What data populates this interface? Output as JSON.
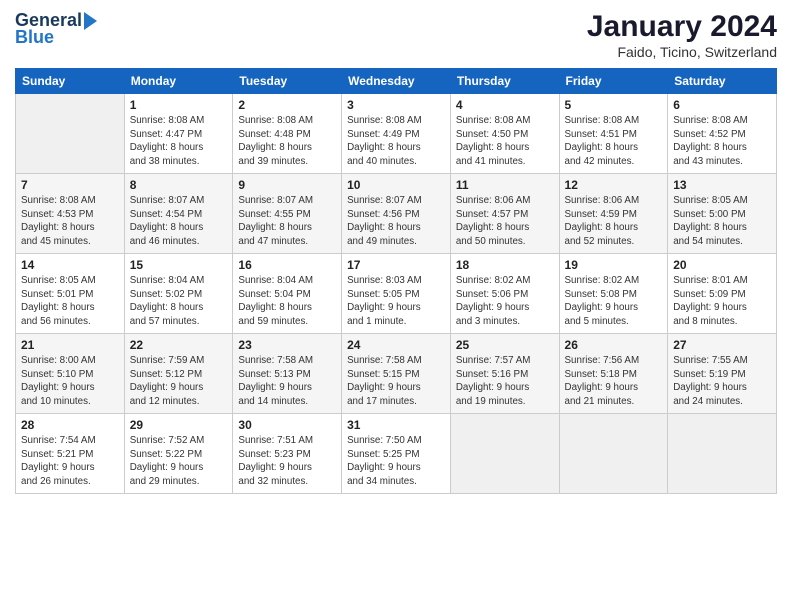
{
  "header": {
    "logo_general": "General",
    "logo_blue": "Blue",
    "month_title": "January 2024",
    "location": "Faido, Ticino, Switzerland"
  },
  "days_of_week": [
    "Sunday",
    "Monday",
    "Tuesday",
    "Wednesday",
    "Thursday",
    "Friday",
    "Saturday"
  ],
  "weeks": [
    [
      {
        "day": "",
        "sunrise": "",
        "sunset": "",
        "daylight": ""
      },
      {
        "day": "1",
        "sunrise": "Sunrise: 8:08 AM",
        "sunset": "Sunset: 4:47 PM",
        "daylight": "Daylight: 8 hours and 38 minutes."
      },
      {
        "day": "2",
        "sunrise": "Sunrise: 8:08 AM",
        "sunset": "Sunset: 4:48 PM",
        "daylight": "Daylight: 8 hours and 39 minutes."
      },
      {
        "day": "3",
        "sunrise": "Sunrise: 8:08 AM",
        "sunset": "Sunset: 4:49 PM",
        "daylight": "Daylight: 8 hours and 40 minutes."
      },
      {
        "day": "4",
        "sunrise": "Sunrise: 8:08 AM",
        "sunset": "Sunset: 4:50 PM",
        "daylight": "Daylight: 8 hours and 41 minutes."
      },
      {
        "day": "5",
        "sunrise": "Sunrise: 8:08 AM",
        "sunset": "Sunset: 4:51 PM",
        "daylight": "Daylight: 8 hours and 42 minutes."
      },
      {
        "day": "6",
        "sunrise": "Sunrise: 8:08 AM",
        "sunset": "Sunset: 4:52 PM",
        "daylight": "Daylight: 8 hours and 43 minutes."
      }
    ],
    [
      {
        "day": "7",
        "sunrise": "Sunrise: 8:08 AM",
        "sunset": "Sunset: 4:53 PM",
        "daylight": "Daylight: 8 hours and 45 minutes."
      },
      {
        "day": "8",
        "sunrise": "Sunrise: 8:07 AM",
        "sunset": "Sunset: 4:54 PM",
        "daylight": "Daylight: 8 hours and 46 minutes."
      },
      {
        "day": "9",
        "sunrise": "Sunrise: 8:07 AM",
        "sunset": "Sunset: 4:55 PM",
        "daylight": "Daylight: 8 hours and 47 minutes."
      },
      {
        "day": "10",
        "sunrise": "Sunrise: 8:07 AM",
        "sunset": "Sunset: 4:56 PM",
        "daylight": "Daylight: 8 hours and 49 minutes."
      },
      {
        "day": "11",
        "sunrise": "Sunrise: 8:06 AM",
        "sunset": "Sunset: 4:57 PM",
        "daylight": "Daylight: 8 hours and 50 minutes."
      },
      {
        "day": "12",
        "sunrise": "Sunrise: 8:06 AM",
        "sunset": "Sunset: 4:59 PM",
        "daylight": "Daylight: 8 hours and 52 minutes."
      },
      {
        "day": "13",
        "sunrise": "Sunrise: 8:05 AM",
        "sunset": "Sunset: 5:00 PM",
        "daylight": "Daylight: 8 hours and 54 minutes."
      }
    ],
    [
      {
        "day": "14",
        "sunrise": "Sunrise: 8:05 AM",
        "sunset": "Sunset: 5:01 PM",
        "daylight": "Daylight: 8 hours and 56 minutes."
      },
      {
        "day": "15",
        "sunrise": "Sunrise: 8:04 AM",
        "sunset": "Sunset: 5:02 PM",
        "daylight": "Daylight: 8 hours and 57 minutes."
      },
      {
        "day": "16",
        "sunrise": "Sunrise: 8:04 AM",
        "sunset": "Sunset: 5:04 PM",
        "daylight": "Daylight: 8 hours and 59 minutes."
      },
      {
        "day": "17",
        "sunrise": "Sunrise: 8:03 AM",
        "sunset": "Sunset: 5:05 PM",
        "daylight": "Daylight: 9 hours and 1 minute."
      },
      {
        "day": "18",
        "sunrise": "Sunrise: 8:02 AM",
        "sunset": "Sunset: 5:06 PM",
        "daylight": "Daylight: 9 hours and 3 minutes."
      },
      {
        "day": "19",
        "sunrise": "Sunrise: 8:02 AM",
        "sunset": "Sunset: 5:08 PM",
        "daylight": "Daylight: 9 hours and 5 minutes."
      },
      {
        "day": "20",
        "sunrise": "Sunrise: 8:01 AM",
        "sunset": "Sunset: 5:09 PM",
        "daylight": "Daylight: 9 hours and 8 minutes."
      }
    ],
    [
      {
        "day": "21",
        "sunrise": "Sunrise: 8:00 AM",
        "sunset": "Sunset: 5:10 PM",
        "daylight": "Daylight: 9 hours and 10 minutes."
      },
      {
        "day": "22",
        "sunrise": "Sunrise: 7:59 AM",
        "sunset": "Sunset: 5:12 PM",
        "daylight": "Daylight: 9 hours and 12 minutes."
      },
      {
        "day": "23",
        "sunrise": "Sunrise: 7:58 AM",
        "sunset": "Sunset: 5:13 PM",
        "daylight": "Daylight: 9 hours and 14 minutes."
      },
      {
        "day": "24",
        "sunrise": "Sunrise: 7:58 AM",
        "sunset": "Sunset: 5:15 PM",
        "daylight": "Daylight: 9 hours and 17 minutes."
      },
      {
        "day": "25",
        "sunrise": "Sunrise: 7:57 AM",
        "sunset": "Sunset: 5:16 PM",
        "daylight": "Daylight: 9 hours and 19 minutes."
      },
      {
        "day": "26",
        "sunrise": "Sunrise: 7:56 AM",
        "sunset": "Sunset: 5:18 PM",
        "daylight": "Daylight: 9 hours and 21 minutes."
      },
      {
        "day": "27",
        "sunrise": "Sunrise: 7:55 AM",
        "sunset": "Sunset: 5:19 PM",
        "daylight": "Daylight: 9 hours and 24 minutes."
      }
    ],
    [
      {
        "day": "28",
        "sunrise": "Sunrise: 7:54 AM",
        "sunset": "Sunset: 5:21 PM",
        "daylight": "Daylight: 9 hours and 26 minutes."
      },
      {
        "day": "29",
        "sunrise": "Sunrise: 7:52 AM",
        "sunset": "Sunset: 5:22 PM",
        "daylight": "Daylight: 9 hours and 29 minutes."
      },
      {
        "day": "30",
        "sunrise": "Sunrise: 7:51 AM",
        "sunset": "Sunset: 5:23 PM",
        "daylight": "Daylight: 9 hours and 32 minutes."
      },
      {
        "day": "31",
        "sunrise": "Sunrise: 7:50 AM",
        "sunset": "Sunset: 5:25 PM",
        "daylight": "Daylight: 9 hours and 34 minutes."
      },
      {
        "day": "",
        "sunrise": "",
        "sunset": "",
        "daylight": ""
      },
      {
        "day": "",
        "sunrise": "",
        "sunset": "",
        "daylight": ""
      },
      {
        "day": "",
        "sunrise": "",
        "sunset": "",
        "daylight": ""
      }
    ]
  ]
}
